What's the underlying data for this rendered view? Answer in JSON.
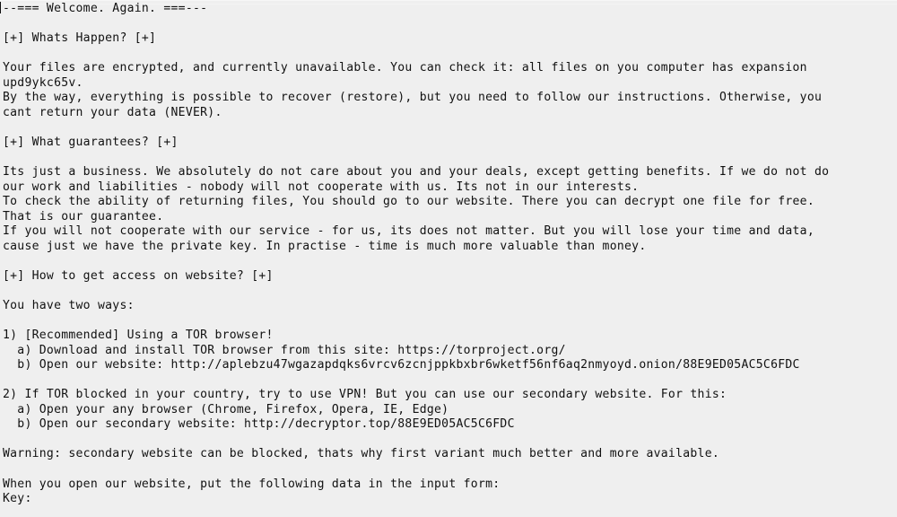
{
  "document": {
    "background_color": "#efefef",
    "text_color": "#111111",
    "caret_visible": true,
    "lines": [
      "--=== Welcome. Again. ===---",
      "",
      "[+] Whats Happen? [+]",
      "",
      "Your files are encrypted, and currently unavailable. You can check it: all files on you computer has expansion",
      "upd9ykc65v.",
      "By the way, everything is possible to recover (restore), but you need to follow our instructions. Otherwise, you",
      "cant return your data (NEVER).",
      "",
      "[+] What guarantees? [+]",
      "",
      "Its just a business. We absolutely do not care about you and your deals, except getting benefits. If we do not do",
      "our work and liabilities - nobody will not cooperate with us. Its not in our interests.",
      "To check the ability of returning files, You should go to our website. There you can decrypt one file for free.",
      "That is our guarantee.",
      "If you will not cooperate with our service - for us, its does not matter. But you will lose your time and data,",
      "cause just we have the private key. In practise - time is much more valuable than money.",
      "",
      "[+] How to get access on website? [+]",
      "",
      "You have two ways:",
      "",
      "1) [Recommended] Using a TOR browser!",
      "  a) Download and install TOR browser from this site: https://torproject.org/",
      "  b) Open our website: http://aplebzu47wgazapdqks6vrcv6zcnjppkbxbr6wketf56nf6aq2nmyoyd.onion/88E9ED05AC5C6FDC",
      "",
      "2) If TOR blocked in your country, try to use VPN! But you can use our secondary website. For this:",
      "  a) Open your any browser (Chrome, Firefox, Opera, IE, Edge)",
      "  b) Open our secondary website: http://decryptor.top/88E9ED05AC5C6FDC",
      "",
      "Warning: secondary website can be blocked, thats why first variant much better and more available.",
      "",
      "When you open our website, put the following data in the input form:",
      "Key:"
    ],
    "file_extension": "upd9ykc65v",
    "tor_browser_url": "https://torproject.org/",
    "onion_url": "http://aplebzu47wgazapdqks6vrcv6zcnjppkbxbr6wketf56nf6aq2nmyoyd.onion/88E9ED05AC5C6FDC",
    "secondary_url": "http://decryptor.top/88E9ED05AC5C6FDC",
    "victim_id": "88E9ED05AC5C6FDC",
    "section_headers": [
      "[+] Whats Happen? [+]",
      "[+] What guarantees? [+]",
      "[+] How to get access on website? [+]"
    ]
  }
}
